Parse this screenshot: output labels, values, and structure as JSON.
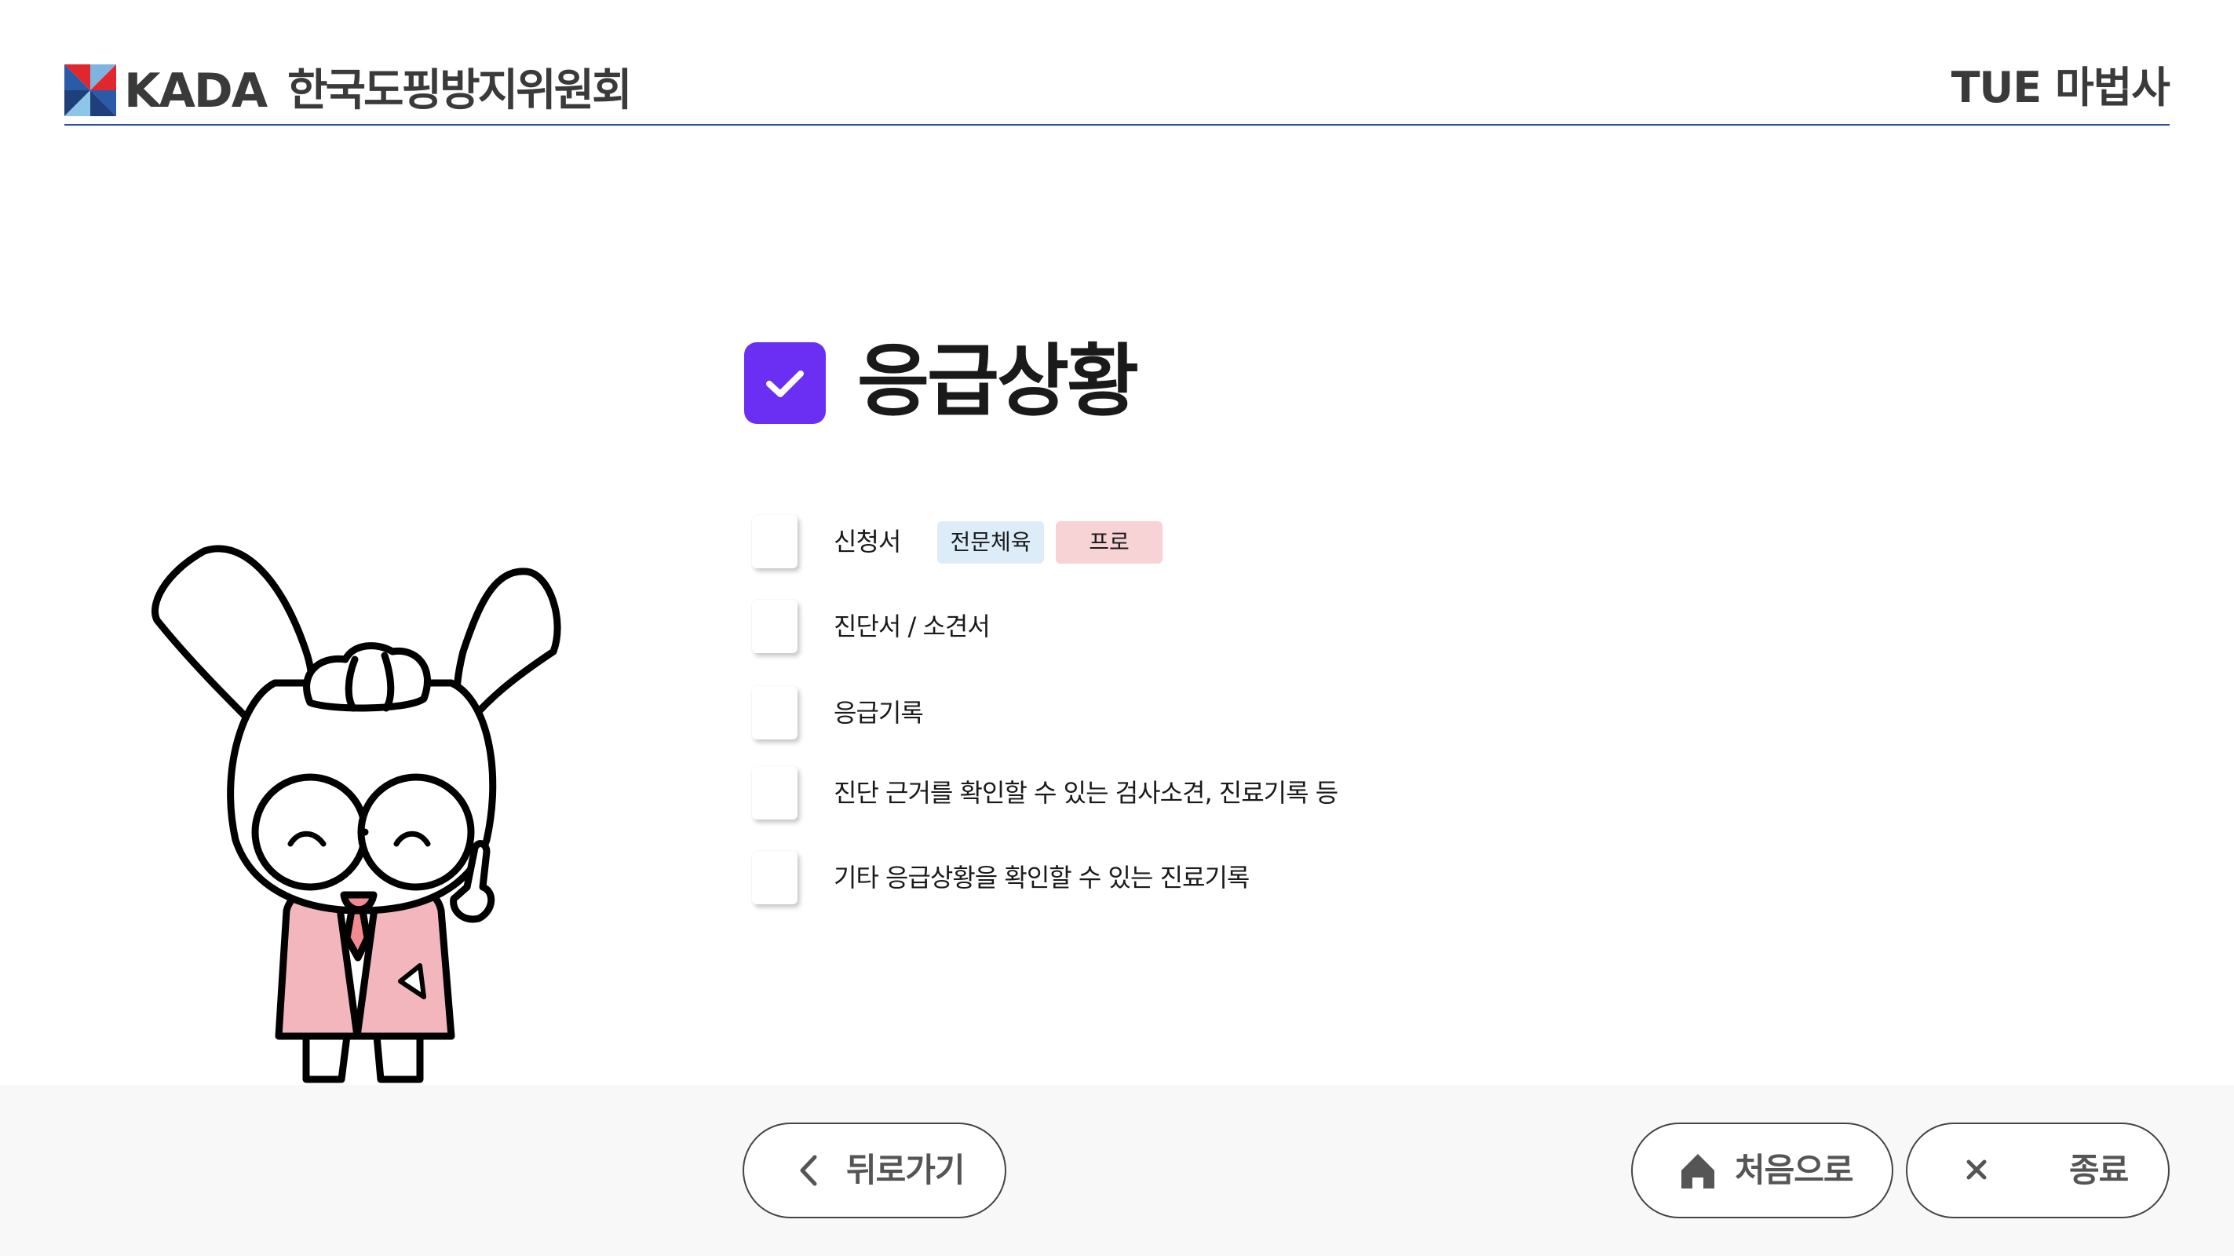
{
  "header": {
    "brand": "KADA",
    "org_name": "한국도핑방지위원회",
    "right_title": "TUE 마법사"
  },
  "section": {
    "title": "응급상황"
  },
  "checklist": {
    "items": [
      {
        "label": "신청서",
        "badges": [
          "전문체육",
          "프로"
        ]
      },
      {
        "label": "진단서 / 소견서"
      },
      {
        "label": "응급기록"
      },
      {
        "label": "진단 근거를 확인할 수 있는 검사소견, 진료기록 등"
      },
      {
        "label": "기타 응급상황을 확인할 수 있는 진료기록"
      }
    ]
  },
  "footer": {
    "back_label": "뒤로가기",
    "home_label": "처음으로",
    "exit_label": "종료"
  },
  "colors": {
    "accent": "#6a2ff2",
    "header_line": "#2a4f9b",
    "badge_blue": "#dcedf9",
    "badge_pink": "#f8d3d5",
    "footer_bg": "#f8f8f8"
  },
  "icons": {
    "title": "check-icon",
    "back": "chevron-left-icon",
    "home": "home-icon",
    "exit": "close-icon"
  }
}
